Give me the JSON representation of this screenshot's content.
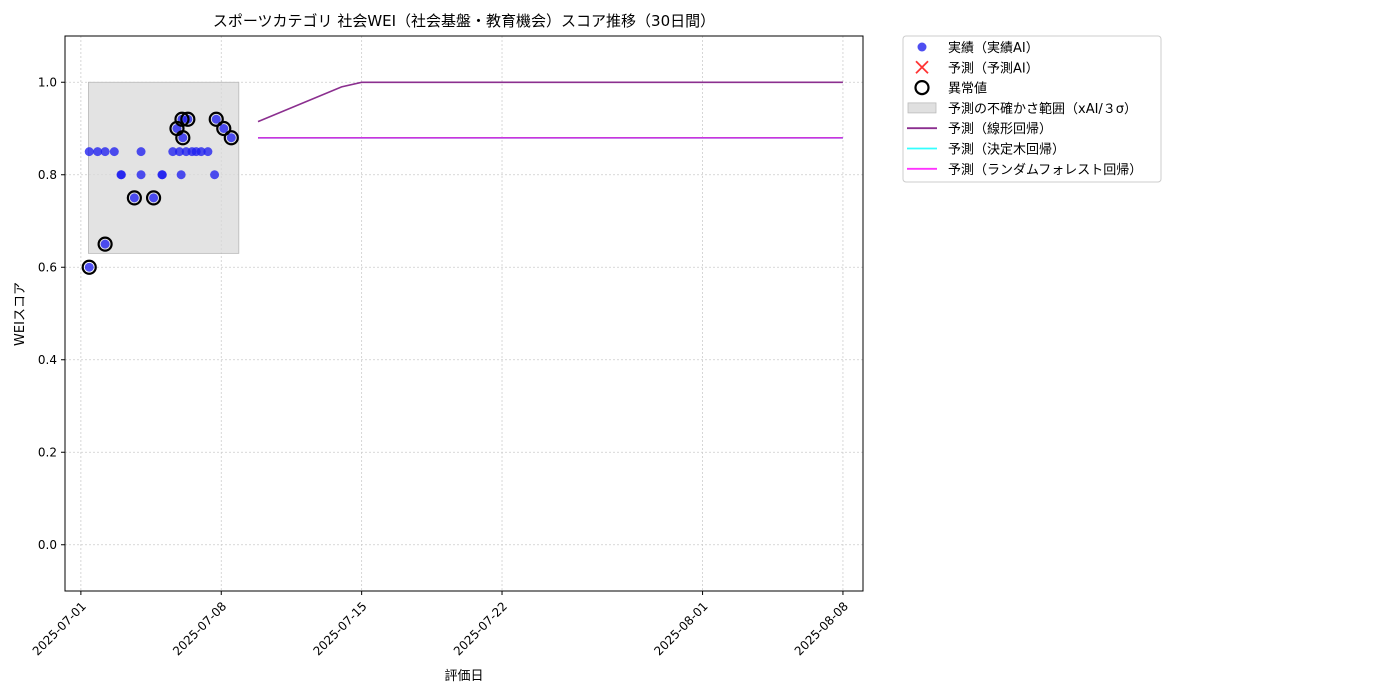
{
  "chart_data": {
    "type": "scatter",
    "title": "スポーツカテゴリ 社会WEI（社会基盤・教育機会）スコア推移（30日間）",
    "xlabel": "評価日",
    "ylabel": "WEIスコア",
    "xlim": [
      "2025-06-30T05:00",
      "2025-08-09T00:00"
    ],
    "ylim": [
      -0.1,
      1.1
    ],
    "x_ticks": [
      "2025-07-01",
      "2025-07-08",
      "2025-07-15",
      "2025-07-22",
      "2025-08-01",
      "2025-08-08"
    ],
    "y_ticks": [
      0.0,
      0.2,
      0.4,
      0.6,
      0.8,
      1.0
    ],
    "y_tick_labels": [
      "0.0",
      "0.2",
      "0.4",
      "0.6",
      "0.8",
      "1.0"
    ],
    "grid": true,
    "legend_position": "outside-upper-right",
    "colors": {
      "actual": "#1f1fef",
      "predicted": "#ff3333",
      "anomaly": "#000000",
      "band": "#d9d9d9",
      "linear": "#8b2f8f",
      "tree": "#00ffff",
      "forest": "#cc33dd"
    },
    "legend": [
      {
        "label": "実績（実績AI）",
        "kind": "dot",
        "color": "#2f2fef"
      },
      {
        "label": "予測（予測AI）",
        "kind": "cross",
        "color": "#ff3333"
      },
      {
        "label": "異常値",
        "kind": "ring",
        "color": "#000000"
      },
      {
        "label": "予測の不確かさ範囲（xAI/３σ）",
        "kind": "rect",
        "color": "#e0e0e0"
      },
      {
        "label": "予測（線形回帰）",
        "kind": "line",
        "color": "#8b2f8f"
      },
      {
        "label": "予測（決定木回帰）",
        "kind": "line",
        "color": "#33ffff"
      },
      {
        "label": "予測（ランダムフォレスト回帰）",
        "kind": "line",
        "color": "#ff33ff"
      }
    ],
    "uncertainty_band": {
      "x": [
        "2025-07-01T09:00",
        "2025-07-08T21:00"
      ],
      "y": [
        0.63,
        1.0
      ]
    },
    "actual_points": [
      {
        "x": "2025-07-01T10:00",
        "y": 0.85
      },
      {
        "x": "2025-07-01T10:00",
        "y": 0.6
      },
      {
        "x": "2025-07-01T20:00",
        "y": 0.85
      },
      {
        "x": "2025-07-02T05:00",
        "y": 0.85
      },
      {
        "x": "2025-07-02T05:00",
        "y": 0.65
      },
      {
        "x": "2025-07-02T16:00",
        "y": 0.85
      },
      {
        "x": "2025-07-03T00:00",
        "y": 0.8
      },
      {
        "x": "2025-07-03T00:30",
        "y": 0.8
      },
      {
        "x": "2025-07-03T16:00",
        "y": 0.75
      },
      {
        "x": "2025-07-04T00:00",
        "y": 0.85
      },
      {
        "x": "2025-07-04T00:00",
        "y": 0.8
      },
      {
        "x": "2025-07-04T15:00",
        "y": 0.75
      },
      {
        "x": "2025-07-05T01:00",
        "y": 0.8
      },
      {
        "x": "2025-07-05T01:30",
        "y": 0.8
      },
      {
        "x": "2025-07-05T14:00",
        "y": 0.85
      },
      {
        "x": "2025-07-05T19:00",
        "y": 0.9
      },
      {
        "x": "2025-07-05T22:00",
        "y": 0.85
      },
      {
        "x": "2025-07-06T00:00",
        "y": 0.8
      },
      {
        "x": "2025-07-06T01:00",
        "y": 0.92
      },
      {
        "x": "2025-07-06T02:00",
        "y": 0.88
      },
      {
        "x": "2025-07-06T06:00",
        "y": 0.85
      },
      {
        "x": "2025-07-06T08:00",
        "y": 0.92
      },
      {
        "x": "2025-07-06T13:00",
        "y": 0.85
      },
      {
        "x": "2025-07-06T18:00",
        "y": 0.85
      },
      {
        "x": "2025-07-07T00:00",
        "y": 0.85
      },
      {
        "x": "2025-07-07T08:00",
        "y": 0.85
      },
      {
        "x": "2025-07-07T16:00",
        "y": 0.8
      },
      {
        "x": "2025-07-07T18:00",
        "y": 0.92
      },
      {
        "x": "2025-07-08T03:00",
        "y": 0.9
      },
      {
        "x": "2025-07-08T12:00",
        "y": 0.88
      }
    ],
    "anomaly_points": [
      {
        "x": "2025-07-01T10:00",
        "y": 0.6
      },
      {
        "x": "2025-07-02T05:00",
        "y": 0.65
      },
      {
        "x": "2025-07-03T16:00",
        "y": 0.75
      },
      {
        "x": "2025-07-04T15:00",
        "y": 0.75
      },
      {
        "x": "2025-07-05T19:00",
        "y": 0.9
      },
      {
        "x": "2025-07-06T01:00",
        "y": 0.92
      },
      {
        "x": "2025-07-06T02:00",
        "y": 0.88
      },
      {
        "x": "2025-07-06T08:00",
        "y": 0.92
      },
      {
        "x": "2025-07-07T18:00",
        "y": 0.92
      },
      {
        "x": "2025-07-08T03:00",
        "y": 0.9
      },
      {
        "x": "2025-07-08T12:00",
        "y": 0.88
      }
    ],
    "series": [
      {
        "key": "linear",
        "x": [
          "2025-07-09T20:00",
          "2025-07-14T00:00",
          "2025-07-15T00:00",
          "2025-08-08T00:00"
        ],
        "y": [
          0.915,
          0.99,
          1.0,
          1.0
        ]
      },
      {
        "key": "tree",
        "x": [
          "2025-07-09T20:00",
          "2025-08-08T00:00"
        ],
        "y": [
          0.88,
          0.88
        ]
      },
      {
        "key": "forest",
        "x": [
          "2025-07-09T20:00",
          "2025-08-08T00:00"
        ],
        "y": [
          0.88,
          0.88
        ]
      }
    ]
  }
}
